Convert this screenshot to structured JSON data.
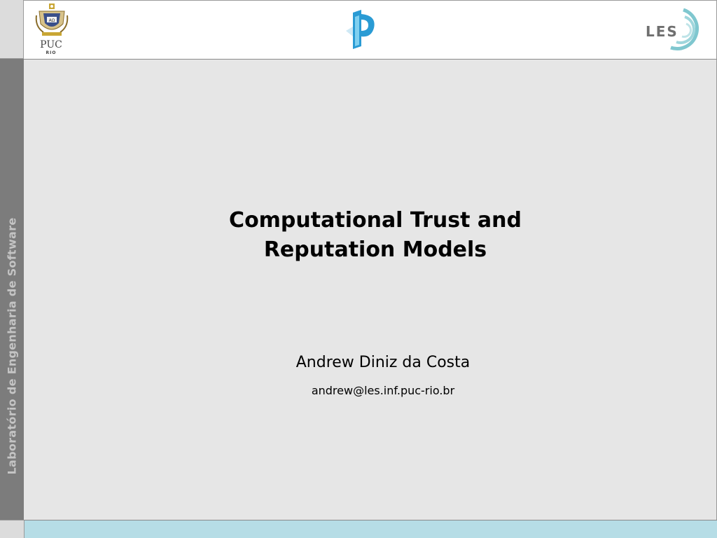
{
  "sidebar": {
    "label": "Laboratório de Engenharia de Software"
  },
  "header": {
    "logos": {
      "left": {
        "icon": "puc-rio-crest-icon",
        "text": "PUC",
        "subtext": "RIO"
      },
      "center": {
        "icon": "ip-logo-icon"
      },
      "right": {
        "icon": "les-logo-icon",
        "text": "LES"
      }
    }
  },
  "slide": {
    "title_line1": "Computational Trust and",
    "title_line2": "Reputation Models",
    "author": "Andrew Diniz da Costa",
    "email": "andrew@les.inf.puc-rio.br"
  },
  "colors": {
    "sidebar": "#7c7c7c",
    "content_bg": "#e6e6e6",
    "footer": "#b6dde6",
    "ip_logo_blue": "#2a9bd4",
    "les_logo_teal": "#7fc7cf"
  }
}
